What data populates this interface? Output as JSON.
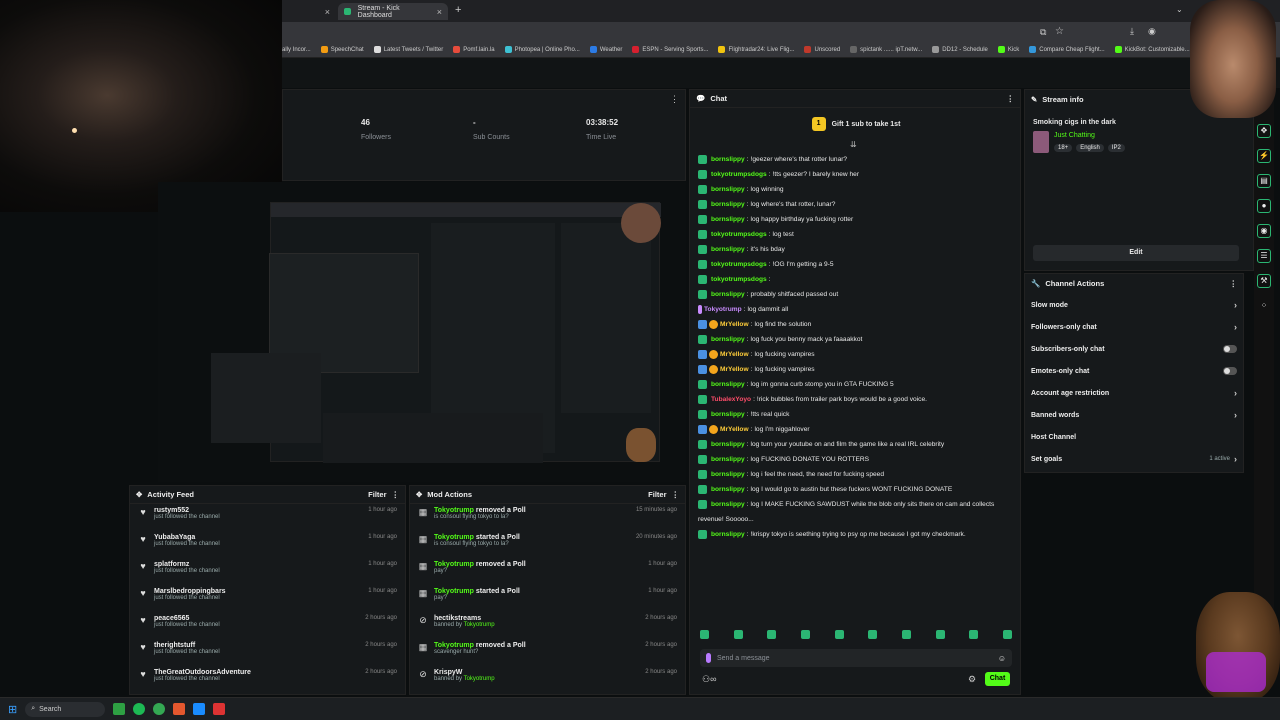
{
  "browser": {
    "tabs": [
      {
        "label": "Stream - Kick Dashboard",
        "active": true
      }
    ],
    "new_tab": "+",
    "bookmarks": [
      "ally Incor...",
      "SpeechChat",
      "Latest Tweets / Twitter",
      "Pomf.lain.la",
      "Photopea | Online Pho...",
      "Weather",
      "ESPN - Serving Sports...",
      "Flightradar24: Live Flig...",
      "Unscored",
      "spictank ...... ipT.netw...",
      "DD12 - Schedule",
      "Kick",
      "Compare Cheap Flight...",
      "KickBot: Customizable..."
    ]
  },
  "stats": [
    {
      "value": "46",
      "label": "Followers"
    },
    {
      "value": "-",
      "label": "Sub Counts"
    },
    {
      "value": "03:38:52",
      "label": "Time Live"
    }
  ],
  "chat": {
    "title": "Chat",
    "pinned": "Gift 1 sub to take 1st",
    "pinned_badge": "1",
    "messages": [
      {
        "user": "bornslippy",
        "text": "!geezer where's that rotter lunar?",
        "color": "green"
      },
      {
        "user": "tokyotrumpsdogs",
        "text": "!tts geezer? I barely knew her",
        "color": "green"
      },
      {
        "user": "bornslippy",
        "text": "log winning",
        "color": "green"
      },
      {
        "user": "bornslippy",
        "text": "log where's that rotter, lunar?",
        "color": "green"
      },
      {
        "user": "bornslippy",
        "text": "log happy birthday ya fucking rotter",
        "color": "green"
      },
      {
        "user": "tokyotrumpsdogs",
        "text": "log test",
        "color": "green"
      },
      {
        "user": "bornslippy",
        "text": "it's his bday",
        "color": "green"
      },
      {
        "user": "tokyotrumpsdogs",
        "text": "!OG I'm getting a 9-5",
        "color": "green"
      },
      {
        "user": "tokyotrumpsdogs",
        "text": "",
        "color": "green"
      },
      {
        "user": "bornslippy",
        "text": "probably shitfaced passed out",
        "color": "green"
      },
      {
        "user": "Tokyotrump",
        "text": "log dammit all",
        "color": "pur"
      },
      {
        "user": "MrYellow",
        "text": "log find the solution",
        "color": "yel"
      },
      {
        "user": "bornslippy",
        "text": "log fuck you benny mack ya faaaakkot",
        "color": "green"
      },
      {
        "user": "MrYellow",
        "text": "log fucking vampires",
        "color": "yel"
      },
      {
        "user": "MrYellow",
        "text": "log fucking vampires",
        "color": "yel"
      },
      {
        "user": "bornslippy",
        "text": "log im gonna curb stomp you in GTA FUCKING 5",
        "color": "green"
      },
      {
        "user": "TubalexYoyo",
        "text": "!rick bubbles from trailer park boys would be a good voice.",
        "color": "red"
      },
      {
        "user": "bornslippy",
        "text": "!tts real quick",
        "color": "green"
      },
      {
        "user": "MrYellow",
        "text": "log I'm niggahlover",
        "color": "yel"
      },
      {
        "user": "bornslippy",
        "text": "log turn your youtube on and film the game like a real IRL celebrity",
        "color": "green"
      },
      {
        "user": "bornslippy",
        "text": "log FUCKING DONATE YOU ROTTERS",
        "color": "green"
      },
      {
        "user": "bornslippy",
        "text": "log i feel the need, the need for fucking speed",
        "color": "green"
      },
      {
        "user": "bornslippy",
        "text": "log I would go to austin but these fuckers WONT FUCKING DONATE",
        "color": "green"
      },
      {
        "user": "bornslippy",
        "text": "log I MAKE FUCKING SAWDUST while the blob only sits there on cam and collects",
        "color": "green"
      },
      {
        "user": "",
        "text": "revenue! Sooooo...",
        "color": "green"
      },
      {
        "user": "bornslippy",
        "text": "!krispy tokyo is seething trying to psy op me because I got my checkmark.",
        "color": "green"
      }
    ],
    "input_placeholder": "Send a message",
    "send_label": "Chat"
  },
  "stream_info": {
    "title": "Stream info",
    "stream_title": "Smoking cigs in the dark",
    "category": "Just Chatting",
    "tags": [
      "18+",
      "English",
      "IP2"
    ],
    "edit_label": "Edit"
  },
  "channel_actions": {
    "title": "Channel Actions",
    "items": [
      {
        "label": "Slow mode",
        "control": "chevron"
      },
      {
        "label": "Followers-only chat",
        "control": "chevron"
      },
      {
        "label": "Subscribers-only chat",
        "control": "toggle"
      },
      {
        "label": "Emotes-only chat",
        "control": "toggle"
      },
      {
        "label": "Account age restriction",
        "control": "chevron"
      },
      {
        "label": "Banned words",
        "control": "chevron"
      },
      {
        "label": "Host Channel",
        "control": "none"
      },
      {
        "label": "Set goals",
        "control": "chevron",
        "extra": "1 active"
      }
    ]
  },
  "activity_feed": {
    "title": "Activity Feed",
    "filter": "Filter",
    "items": [
      {
        "name": "rustym552",
        "sub": "just followed the channel",
        "time": "1 hour ago"
      },
      {
        "name": "YubabaYaga",
        "sub": "just followed the channel",
        "time": "1 hour ago"
      },
      {
        "name": "splatformz",
        "sub": "just followed the channel",
        "time": "1 hour ago"
      },
      {
        "name": "Marslbedroppingbars",
        "sub": "just followed the channel",
        "time": "1 hour ago"
      },
      {
        "name": "peace6565",
        "sub": "just followed the channel",
        "time": "2 hours ago"
      },
      {
        "name": "therightstuff",
        "sub": "just followed the channel",
        "time": "2 hours ago"
      },
      {
        "name": "TheGreatOutdoorsAdventure",
        "sub": "just followed the channel",
        "time": "2 hours ago"
      }
    ]
  },
  "mod_actions": {
    "title": "Mod Actions",
    "filter": "Filter",
    "items": [
      {
        "actor": "Tokyotrump",
        "action": "removed a Poll",
        "sub": "is consoul flying tokyo to la?",
        "time": "15 minutes ago",
        "icon": "poll"
      },
      {
        "actor": "Tokyotrump",
        "action": "started a Poll",
        "sub": "is consoul flying tokyo to la?",
        "time": "20 minutes ago",
        "icon": "poll"
      },
      {
        "actor": "Tokyotrump",
        "action": "removed a Poll",
        "sub": "pay?",
        "time": "1 hour ago",
        "icon": "poll"
      },
      {
        "actor": "Tokyotrump",
        "action": "started a Poll",
        "sub": "pay?",
        "time": "1 hour ago",
        "icon": "poll"
      },
      {
        "actor": "hectikstreams",
        "action": "",
        "sub": "banned by",
        "sub_actor": "Tokyotrump",
        "time": "2 hours ago",
        "icon": "ban"
      },
      {
        "actor": "Tokyotrump",
        "action": "removed a Poll",
        "sub": "scavenger hunt?",
        "time": "2 hours ago",
        "icon": "poll"
      },
      {
        "actor": "KrispyW",
        "action": "",
        "sub": "banned by",
        "sub_actor": "Tokyotrump",
        "time": "2 hours ago",
        "icon": "ban"
      }
    ]
  },
  "taskbar": {
    "search": "Search"
  },
  "colors": {
    "accent": "#53fc18",
    "panel": "#16191b",
    "background": "#0b0e0f"
  }
}
